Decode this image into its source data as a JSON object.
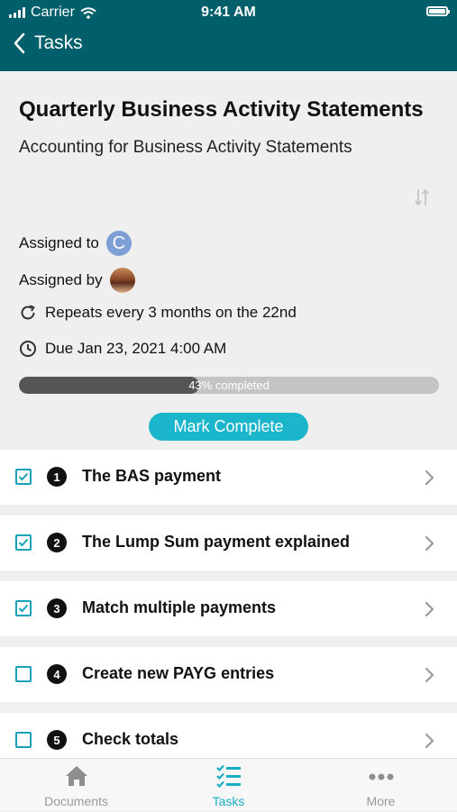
{
  "status_bar": {
    "carrier": "Carrier",
    "time": "9:41 AM"
  },
  "nav": {
    "back_label": "Tasks"
  },
  "task": {
    "title": "Quarterly Business Activity Statements",
    "subtitle": "Accounting for Business Activity Statements",
    "assigned_to_label": "Assigned to",
    "assigned_to_initial": "C",
    "assigned_by_label": "Assigned by",
    "repeat_text": "Repeats every 3 months on the 22nd",
    "due_text": "Due Jan 23, 2021 4:00 AM",
    "progress": {
      "percent": 43,
      "label": "43% completed"
    },
    "mark_complete_label": "Mark Complete"
  },
  "subtasks": [
    {
      "number": "1",
      "label": "The BAS payment",
      "checked": true
    },
    {
      "number": "2",
      "label": "The Lump Sum payment explained",
      "checked": true
    },
    {
      "number": "3",
      "label": "Match multiple payments",
      "checked": true
    },
    {
      "number": "4",
      "label": "Create new PAYG entries",
      "checked": false
    },
    {
      "number": "5",
      "label": "Check totals",
      "checked": false
    }
  ],
  "tabbar": {
    "tabs": [
      {
        "label": "Documents",
        "icon": "home-icon",
        "active": false
      },
      {
        "label": "Tasks",
        "icon": "task-list-icon",
        "active": true
      },
      {
        "label": "More",
        "icon": "more-dots-icon",
        "active": false
      }
    ]
  },
  "colors": {
    "header": "#005f6b",
    "accent": "#1bb5cc",
    "progress_fill": "#555555"
  }
}
